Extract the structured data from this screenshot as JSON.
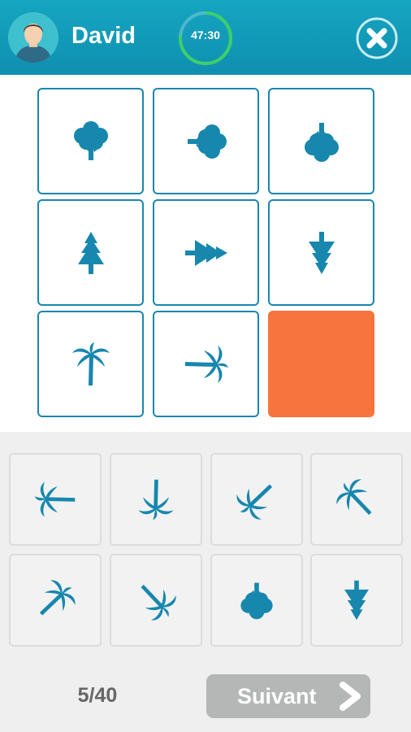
{
  "header": {
    "username": "David",
    "timer": "47:30",
    "colors": {
      "bar": "#15a6c1",
      "timer_ring": "#3ccf6a"
    },
    "icons": {
      "avatar": "user-avatar-icon",
      "close": "close-x-icon"
    }
  },
  "puzzle": {
    "colors": {
      "icon": "#1787ae",
      "border": "#1787ae",
      "empty_cell": "#f7753c"
    },
    "cells": [
      {
        "icon": "deciduous-tree-icon",
        "rotation": 0
      },
      {
        "icon": "deciduous-tree-icon",
        "rotation": 90
      },
      {
        "icon": "deciduous-tree-icon",
        "rotation": 180
      },
      {
        "icon": "pine-tree-icon",
        "rotation": 0
      },
      {
        "icon": "pine-tree-icon",
        "rotation": 90
      },
      {
        "icon": "pine-tree-icon",
        "rotation": 180
      },
      {
        "icon": "palm-tree-icon",
        "rotation": 0
      },
      {
        "icon": "palm-tree-icon",
        "rotation": 90
      },
      {
        "icon": "empty-answer-slot",
        "rotation": null
      }
    ]
  },
  "choices": [
    {
      "icon": "palm-tree-icon",
      "rotation": 270
    },
    {
      "icon": "palm-tree-icon",
      "rotation": 180
    },
    {
      "icon": "palm-tree-icon",
      "rotation": 225
    },
    {
      "icon": "palm-tree-icon",
      "rotation": 315
    },
    {
      "icon": "palm-tree-icon",
      "rotation": 45
    },
    {
      "icon": "palm-tree-icon",
      "rotation": 135
    },
    {
      "icon": "deciduous-tree-icon",
      "rotation": 180
    },
    {
      "icon": "pine-tree-icon",
      "rotation": 180
    }
  ],
  "footer": {
    "progress": "5/40",
    "next_label": "Suivant",
    "next_icon": "chevron-right-icon"
  }
}
